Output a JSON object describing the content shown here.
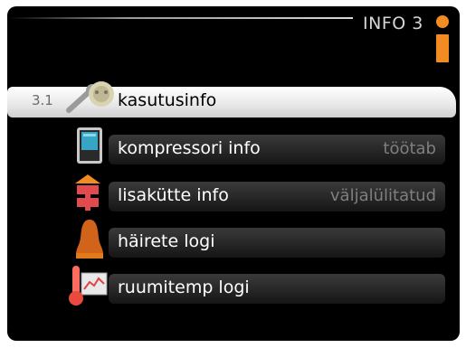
{
  "header": {
    "title": "INFO 3"
  },
  "menu": {
    "selected_index": "3.1",
    "items": [
      {
        "label": "kasutusinfo",
        "status": "",
        "icon": "wrench-gear-icon"
      },
      {
        "label": "kompressori info",
        "status": "töötab",
        "icon": "compressor-icon"
      },
      {
        "label": "lisakütte info",
        "status": "väljalülitatud",
        "icon": "heater-icon"
      },
      {
        "label": "häirete logi",
        "status": "",
        "icon": "alarm-bell-icon"
      },
      {
        "label": "ruumitemp logi",
        "status": "",
        "icon": "thermometer-graph-icon"
      }
    ]
  },
  "colors": {
    "accent": "#e07a1a",
    "text": "#ffffff",
    "muted": "#7f7f7f",
    "background": "#000000"
  }
}
